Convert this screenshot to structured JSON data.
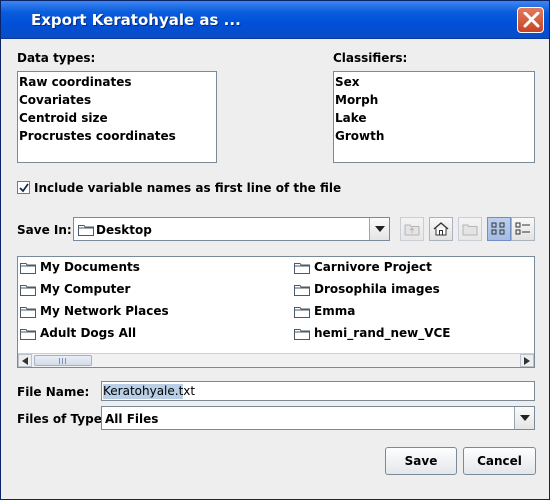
{
  "window": {
    "title": "Export Keratohyale as ..."
  },
  "data_types": {
    "label": "Data types:",
    "items": [
      "Raw coordinates",
      "Covariates",
      "Centroid size",
      "Procrustes coordinates"
    ]
  },
  "classifiers": {
    "label": "Classifiers:",
    "items": [
      "Sex",
      "Morph",
      "Lake",
      "Growth"
    ]
  },
  "include_names": {
    "label": "Include variable names as first line of the file",
    "checked": true
  },
  "save_in": {
    "label": "Save In:",
    "value": "Desktop"
  },
  "toolbar": {
    "icons": [
      "up-one-level-icon",
      "home-icon",
      "new-folder-icon",
      "list-view-icon",
      "details-view-icon"
    ]
  },
  "files": {
    "left": [
      "My Documents",
      "My Computer",
      "My Network Places",
      "Adult Dogs All"
    ],
    "right": [
      "Carnivore Project",
      "Drosophila images",
      "Emma",
      "hemi_rand_new_VCE"
    ]
  },
  "file_name": {
    "label": "File Name:",
    "value": "Keratohyale.txt"
  },
  "files_of_type": {
    "label": "Files of Type:",
    "value": "All Files"
  },
  "buttons": {
    "save": "Save",
    "cancel": "Cancel"
  },
  "colors": {
    "titlebar": "#0050d8",
    "close": "#c84322",
    "selection": "#b8cfe5"
  }
}
